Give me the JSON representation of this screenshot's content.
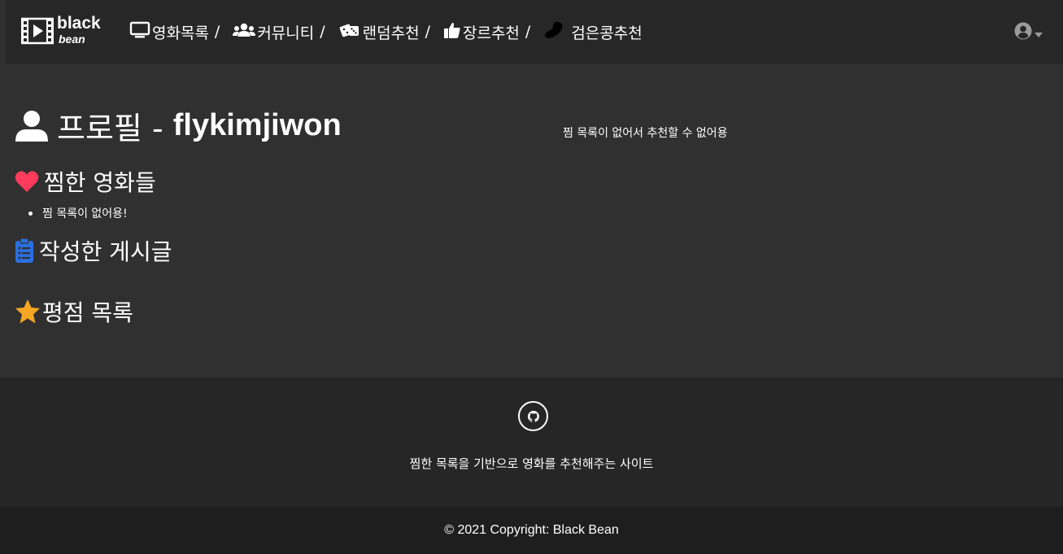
{
  "brand": {
    "line1": "black",
    "line2": "bean"
  },
  "nav": {
    "items": [
      {
        "label": "영화목록",
        "icon": "monitor-icon"
      },
      {
        "label": "커뮤니티",
        "icon": "users-icon"
      },
      {
        "label": "랜덤추천",
        "icon": "dice-icon"
      },
      {
        "label": "장르추천",
        "icon": "thumbs-up-icon"
      },
      {
        "label": "검은콩추천",
        "icon": "bean-icon"
      }
    ],
    "separator": "/"
  },
  "user_menu": {
    "icon": "user-circle-icon",
    "caret": "caret-down-icon"
  },
  "profile": {
    "prefix": "프로필 - ",
    "username": "flykimjiwon"
  },
  "sections": {
    "liked_movies": {
      "title": "찜한 영화들",
      "icon": "heart-icon",
      "color": "#ff3b5c",
      "items": [
        "찜 목록이 없어용!"
      ]
    },
    "posts": {
      "title": "작성한 게시글",
      "icon": "clipboard-icon",
      "color": "#2a6fe0"
    },
    "ratings": {
      "title": "평점 목록",
      "icon": "star-icon",
      "color": "#f5a623"
    }
  },
  "recommend_message": "찜 목록이 없어서 추천할 수 없어용",
  "footer": {
    "github_icon": "github-icon",
    "description": "찜한 목록을 기반으로 영화를 추천해주는 사이트",
    "copyright": "© 2021 Copyright: Black Bean"
  },
  "colors": {
    "background": "#303030",
    "navbar": "#272727",
    "footer": "#262626",
    "copyright": "#1e1e1e"
  }
}
